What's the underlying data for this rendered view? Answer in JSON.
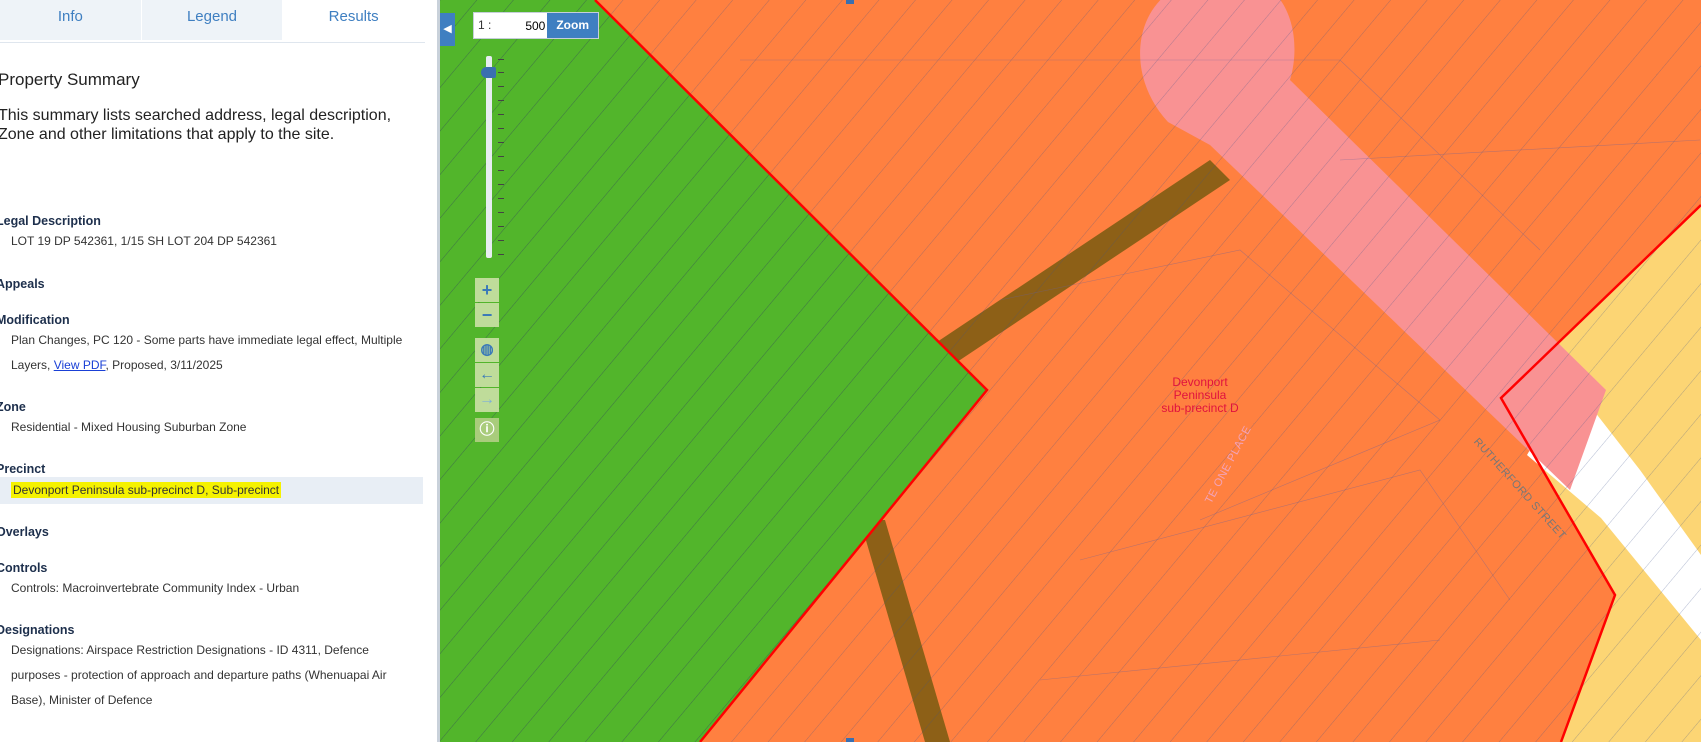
{
  "tabs": [
    {
      "label": "Info"
    },
    {
      "label": "Legend"
    },
    {
      "label": "Results"
    }
  ],
  "summary": {
    "title": "Property Summary",
    "intro": "This summary lists searched address, legal description, Zone and other limitations that apply to the site."
  },
  "sections": {
    "legal": {
      "heading": "Legal Description",
      "value": "LOT 19 DP 542361, 1/15 SH LOT 204 DP 542361"
    },
    "appeals": {
      "heading": "Appeals"
    },
    "modification": {
      "heading": "Modification",
      "line1": "Plan Changes, PC 120 - Some parts have immediate legal effect, Multiple",
      "line2_prefix": "Layers, ",
      "link": "View PDF",
      "line2_suffix": ", Proposed, 3/11/2025"
    },
    "zone": {
      "heading": "Zone",
      "value": "Residential - Mixed Housing Suburban Zone"
    },
    "precinct": {
      "heading": "Precinct",
      "value": "Devonport Peninsula sub-precinct D, Sub-precinct"
    },
    "overlays": {
      "heading": "Overlays"
    },
    "controls": {
      "heading": "Controls",
      "value": "Controls: Macroinvertebrate Community Index - Urban"
    },
    "designations": {
      "heading": "Designations",
      "line1": "Designations: Airspace Restriction Designations - ID 4311, Defence",
      "line2": "purposes - protection of approach and departure paths (Whenuapai Air",
      "line3": "Base), Minister of Defence"
    }
  },
  "map": {
    "scale_prefix": "1 :",
    "scale_value": "500",
    "zoom_label": "Zoom",
    "zoom_in": "+",
    "zoom_out": "−",
    "precinct_label": [
      "Devonport",
      "Peninsula",
      "sub-precinct D"
    ],
    "street_1": "RUTHERFORD STREET",
    "street_2": "TE ONE PLACE",
    "colors": {
      "green_zone": "#52b52b",
      "orange_zone": "#ff8040",
      "yellow_zone": "#fcd574",
      "road_pink": "#f99293",
      "path_brown": "#8d6017",
      "boundary_red": "#ff0000"
    }
  }
}
